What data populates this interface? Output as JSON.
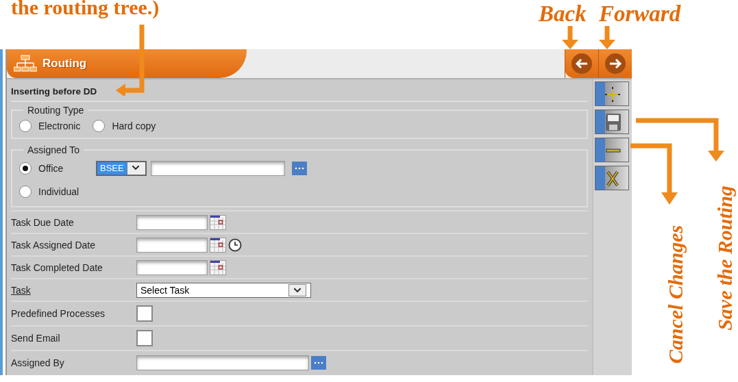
{
  "annotations": [
    {
      "kind": "heading",
      "text": "the routing tree.)"
    },
    {
      "kind": "back",
      "text": "Back"
    },
    {
      "kind": "forward",
      "text": "Forward"
    },
    {
      "kind": "save",
      "text": "Save the Routing"
    },
    {
      "kind": "cancel",
      "text": "Cancel Changes"
    }
  ],
  "panel": {
    "title": "Routing",
    "status": "Inserting before DD",
    "routing_type": {
      "legend": "Routing Type",
      "options": [
        {
          "label": "Electronic",
          "selected": false
        },
        {
          "label": "Hard copy",
          "selected": false
        }
      ]
    },
    "assigned_to": {
      "legend": "Assigned To",
      "office_code": "BSEE",
      "options": [
        {
          "label": "Office",
          "selected": true
        },
        {
          "label": "Individual",
          "selected": false
        }
      ]
    },
    "fields": [
      {
        "kind": "date",
        "label": "Task Due Date",
        "link": false
      },
      {
        "kind": "datetime",
        "label": "Task Assigned Date",
        "link": false
      },
      {
        "kind": "date",
        "label": "Task Completed Date",
        "link": false
      },
      {
        "kind": "select",
        "label": "Task",
        "link": true,
        "value": "Select Task"
      },
      {
        "kind": "checkbox",
        "label": "Predefined Processes",
        "link": false,
        "checked": false
      },
      {
        "kind": "checkbox",
        "label": "Send Email",
        "link": false,
        "checked": false
      },
      {
        "kind": "lookup",
        "label": "Assigned By",
        "link": false
      }
    ],
    "tools": [
      {
        "kind": "add"
      },
      {
        "kind": "save"
      },
      {
        "kind": "minus"
      },
      {
        "kind": "delete"
      }
    ]
  }
}
